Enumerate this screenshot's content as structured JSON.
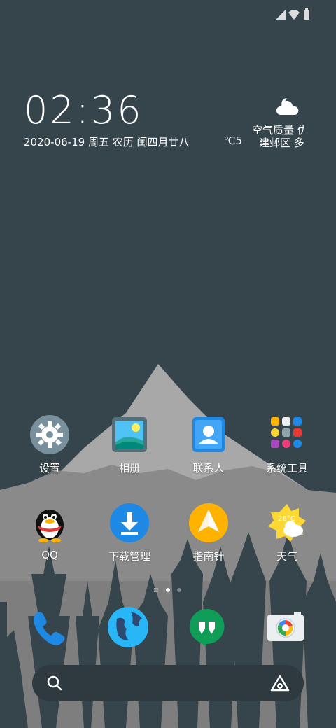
{
  "status": {
    "icons": [
      "signal-icon",
      "wifi-icon",
      "battery-icon"
    ]
  },
  "clock": {
    "time": "02:36",
    "date": "2020-06-19 周五 农历 闰四月廿八"
  },
  "weather": {
    "temp": "5℃",
    "aqi": "空气质量 优",
    "location": "建邺区 多云",
    "icon": "partly-cloudy-night-icon"
  },
  "apps_row1": [
    {
      "label": "设置",
      "icon": "settings-icon"
    },
    {
      "label": "相册",
      "icon": "gallery-icon"
    },
    {
      "label": "联系人",
      "icon": "contacts-icon"
    },
    {
      "label": "系统工具",
      "icon": "folder-icon"
    }
  ],
  "apps_row2": [
    {
      "label": "QQ",
      "icon": "qq-icon"
    },
    {
      "label": "下载管理",
      "icon": "download-icon"
    },
    {
      "label": "指南针",
      "icon": "compass-icon"
    },
    {
      "label": "天气",
      "icon": "weather-icon",
      "badge": "26°C"
    }
  ],
  "dock": [
    {
      "icon": "phone-icon"
    },
    {
      "icon": "browser-icon"
    },
    {
      "icon": "messages-icon"
    },
    {
      "icon": "camera-icon"
    }
  ],
  "search": {
    "icon": "search-icon",
    "assistant_icon": "assistant-icon"
  },
  "colors": {
    "wallpaper_sky": "#36444b",
    "mountain_light": "#a9a9a9",
    "mountain_mid": "#888888",
    "trees": "#36444b"
  }
}
